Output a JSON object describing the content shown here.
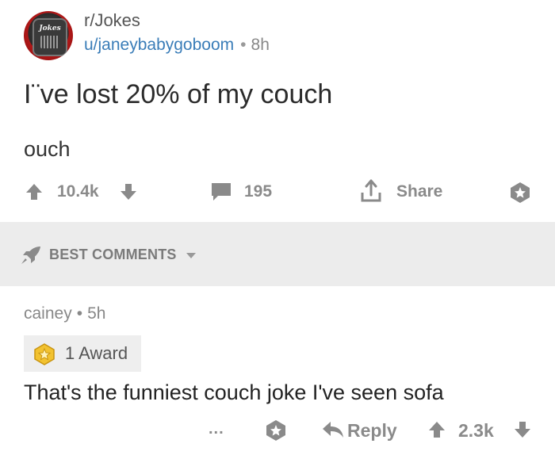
{
  "post": {
    "subreddit": "r/Jokes",
    "subreddit_logo_text": "Jokes",
    "author": "u/janeybabygoboom",
    "separator": "•",
    "time": "8h",
    "title": "I¨ve lost 20% of my couch",
    "body": "ouch"
  },
  "actions": {
    "score": "10.4k",
    "comments": "195",
    "share": "Share"
  },
  "section": {
    "label": "BEST COMMENTS"
  },
  "comment": {
    "author": "cainey",
    "separator": "•",
    "time": "5h",
    "award": "1 Award",
    "text": "That's the funniest couch joke I've seen sofa",
    "more": "...",
    "reply": "Reply",
    "score": "2.3k"
  },
  "colors": {
    "link": "#3a7db8",
    "icon_gray": "#8a8a8a",
    "band": "#ececec",
    "award_gold": "#f2c230"
  }
}
